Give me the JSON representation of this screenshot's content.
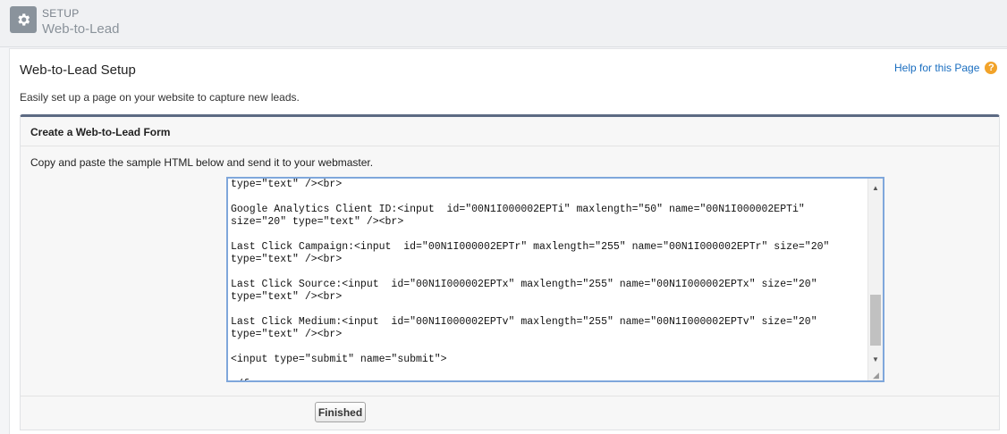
{
  "header": {
    "eyebrow": "SETUP",
    "title": "Web-to-Lead",
    "icon": "gear-icon"
  },
  "page": {
    "title": "Web-to-Lead Setup",
    "help_label": "Help for this Page",
    "help_icon": "question-icon",
    "intro": "Easily set up a page on your website to capture new leads."
  },
  "form": {
    "title": "Create a Web-to-Lead Form",
    "instructions": "Copy and paste the sample HTML below and send it to your webmaster.",
    "code_lines": [
      "type=\"text\" /><br>",
      "",
      "Google Analytics Client ID:<input  id=\"00N1I000002EPTi\" maxlength=\"50\" name=\"00N1I000002EPTi\"",
      "size=\"20\" type=\"text\" /><br>",
      "",
      "Last Click Campaign:<input  id=\"00N1I000002EPTr\" maxlength=\"255\" name=\"00N1I000002EPTr\" size=\"20\"",
      "type=\"text\" /><br>",
      "",
      "Last Click Source:<input  id=\"00N1I000002EPTx\" maxlength=\"255\" name=\"00N1I000002EPTx\" size=\"20\"",
      "type=\"text\" /><br>",
      "",
      "Last Click Medium:<input  id=\"00N1I000002EPTv\" maxlength=\"255\" name=\"00N1I000002EPTv\" size=\"20\"",
      "type=\"text\" /><br>",
      "",
      "<input type=\"submit\" name=\"submit\">",
      "",
      "</form>"
    ],
    "finished_label": "Finished"
  },
  "colors": {
    "accent_link": "#1a6ec0",
    "block_border": "#5c6a83",
    "textarea_focus": "#7fa7db",
    "help_icon": "#f2a32a"
  }
}
